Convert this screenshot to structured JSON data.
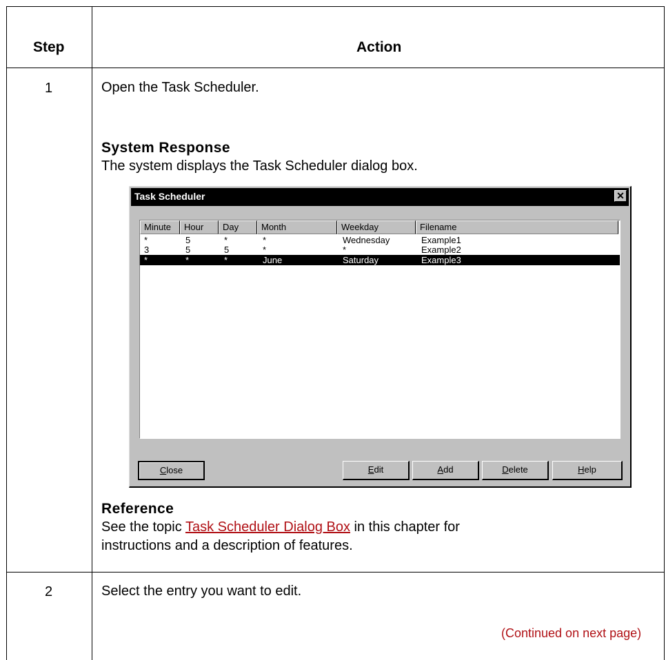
{
  "table": {
    "headers": {
      "step": "Step",
      "action": "Action"
    },
    "rows": [
      {
        "step": "1",
        "instruction": "Open the Task Scheduler.",
        "system_response_heading": "System Response",
        "system_response_text": "The system displays the Task Scheduler dialog box.",
        "reference_heading": "Reference",
        "reference_prefix": "See the topic ",
        "reference_link": "Task Scheduler Dialog Box",
        "reference_suffix": " in this chapter for",
        "reference_line2": "instructions and a description of features."
      },
      {
        "step": "2",
        "instruction": "Select the entry you want to edit."
      }
    ],
    "continued": "(Continued on next page)"
  },
  "dialog": {
    "title": "Task Scheduler",
    "close_glyph": "✕",
    "columns": [
      "Minute",
      "Hour",
      "Day",
      "Month",
      "Weekday",
      "Filename"
    ],
    "entries": [
      {
        "minute": "*",
        "hour": "5",
        "day": "*",
        "month": "*",
        "weekday": "Wednesday",
        "filename": "Example1",
        "selected": false
      },
      {
        "minute": "3",
        "hour": "5",
        "day": "5",
        "month": "*",
        "weekday": "*",
        "filename": "Example2",
        "selected": false
      },
      {
        "minute": "*",
        "hour": "*",
        "day": "*",
        "month": "June",
        "weekday": "Saturday",
        "filename": "Example3",
        "selected": true
      }
    ],
    "buttons": {
      "close": {
        "mnemonic": "C",
        "rest": "lose"
      },
      "edit": {
        "mnemonic": "E",
        "rest": "dit"
      },
      "add": {
        "mnemonic": "A",
        "rest": "dd"
      },
      "delete": {
        "mnemonic": "D",
        "rest": "elete"
      },
      "help": {
        "mnemonic": "H",
        "rest": "elp"
      }
    }
  },
  "colors": {
    "link": "#b01015",
    "selection": "#000000",
    "dialog_face": "#c0c0c0"
  }
}
